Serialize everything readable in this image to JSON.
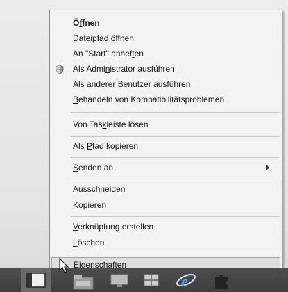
{
  "context_menu": {
    "items": [
      {
        "label": "Öffnen",
        "bold": true,
        "u": 1
      },
      {
        "label": "Dateipfad öffnen",
        "u": 1
      },
      {
        "label": "An \"Start\" anheften",
        "u": 16
      },
      {
        "label": "Als Administrator ausführen",
        "u": 8,
        "icon": "shield-icon"
      },
      {
        "label": "Als anderer Benutzer ausführen",
        "u": 23
      },
      {
        "label": "Behandeln von Kompatibilitätsproblemen",
        "u": 0
      },
      {
        "label": "Von Taskleiste lösen",
        "u": 7
      },
      {
        "label": "Als Pfad kopieren",
        "u": 4
      },
      {
        "label": "Senden an",
        "u": 0,
        "submenu": true
      },
      {
        "label": "Ausschneiden",
        "u": 0
      },
      {
        "label": "Kopieren",
        "u": 0
      },
      {
        "label": "Verknüpfung erstellen",
        "u": 0
      },
      {
        "label": "Löschen",
        "u": 0
      },
      {
        "label": "Eigenschaften",
        "u": 1,
        "highlighted": true
      }
    ]
  },
  "taskbar": {
    "buttons": [
      {
        "icon": "window-icon"
      },
      {
        "icon": "file-explorer-icon"
      },
      {
        "icon": "desktop-app-icon"
      },
      {
        "icon": "network-icon"
      },
      {
        "icon": "internet-explorer-icon"
      },
      {
        "icon": "puzzle-icon"
      }
    ]
  },
  "colors": {
    "menu_bg": "#f3f3f3",
    "highlight_bg": "#dedede",
    "taskbar_bg": "#454545",
    "ie_blue": "#5aa0e0"
  }
}
